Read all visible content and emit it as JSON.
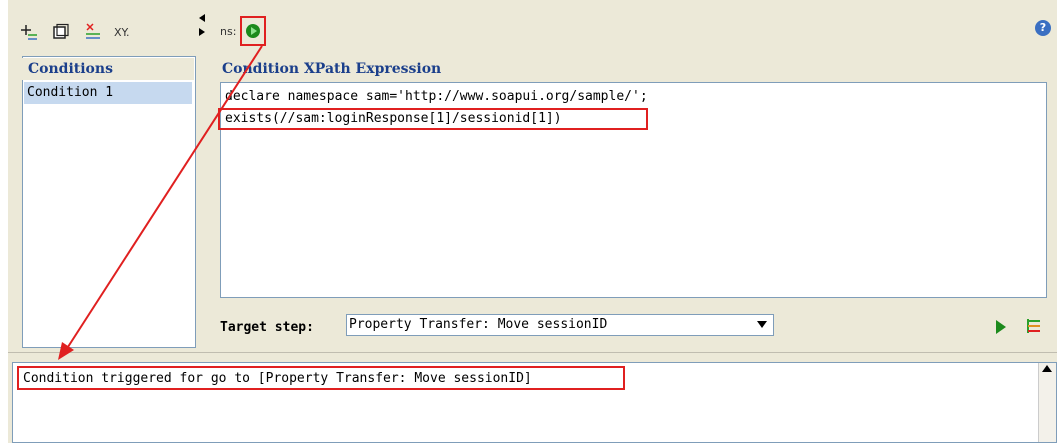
{
  "left_toolbar": {
    "icons": [
      "add-condition-icon",
      "copy-icon",
      "delete-condition-icon"
    ],
    "xy_label": "XY."
  },
  "conditions": {
    "header": "Conditions",
    "items": [
      "Condition 1"
    ]
  },
  "right_toolbar": {
    "ns_label": "ns:",
    "run_icon": "run-condition-icon",
    "help_icon": "?"
  },
  "xpath": {
    "header": "Condition XPath Expression",
    "lines": [
      "declare namespace sam='http://www.soapui.org/sample/';",
      "exists(//sam:loginResponse[1]/sessionid[1])"
    ]
  },
  "target": {
    "label": "Target step:",
    "selected": "Property Transfer: Move sessionID"
  },
  "log": {
    "lines": [
      "Condition triggered for go to [Property Transfer: Move sessionID]"
    ]
  },
  "colors": {
    "highlight": "#e02020",
    "header_text": "#1b3f8b",
    "selection": "#c6d9ef",
    "panel_bg": "#ece9d8"
  }
}
